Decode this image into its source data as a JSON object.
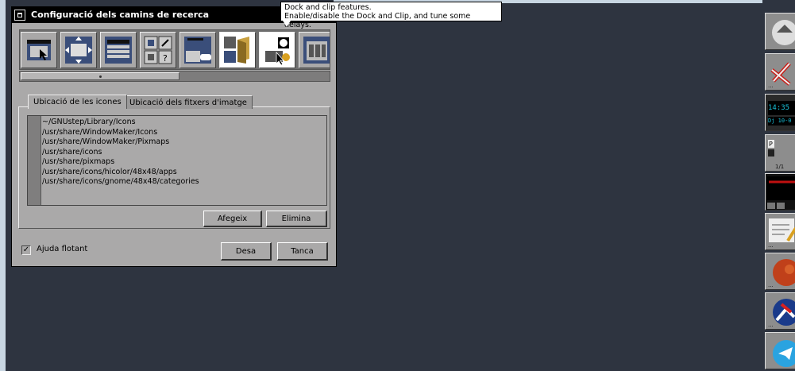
{
  "window": {
    "title": "Configuració dels camins de recerca"
  },
  "tooltip": {
    "line1": "Dock and clip features.",
    "line2": "Enable/disable the Dock and Clip, and tune some delays."
  },
  "toolbar": {
    "icons": [
      "window-handling-icon",
      "window-placement-icon",
      "menu-preferences-icon",
      "icon-preferences-icon",
      "workspace-preferences-icon",
      "search-paths-icon",
      "dock-clip-icon",
      "other-preferences-icon"
    ]
  },
  "tabs": {
    "icon_paths_label": "Ubicació de les icones",
    "image_paths_label": "Ubicació dels fitxers d'imatge"
  },
  "paths": [
    "~/GNUstep/Library/Icons",
    "/usr/share/WindowMaker/Icons",
    "/usr/share/WindowMaker/Pixmaps",
    "/usr/share/icons",
    "/usr/share/pixmaps",
    "/usr/share/icons/hicolor/48x48/apps",
    "/usr/share/icons/gnome/48x48/categories"
  ],
  "buttons": {
    "add": "Afegeix",
    "remove": "Elimina",
    "save": "Desa",
    "close": "Tanca"
  },
  "balloon_help": {
    "label": "Ajuda flotant",
    "checked": true,
    "mark": "✓"
  },
  "dock": {
    "clock_time": "14:35",
    "clock_date": "Dj 10-0",
    "pager_text": "1/1",
    "ellipsis": "..."
  }
}
